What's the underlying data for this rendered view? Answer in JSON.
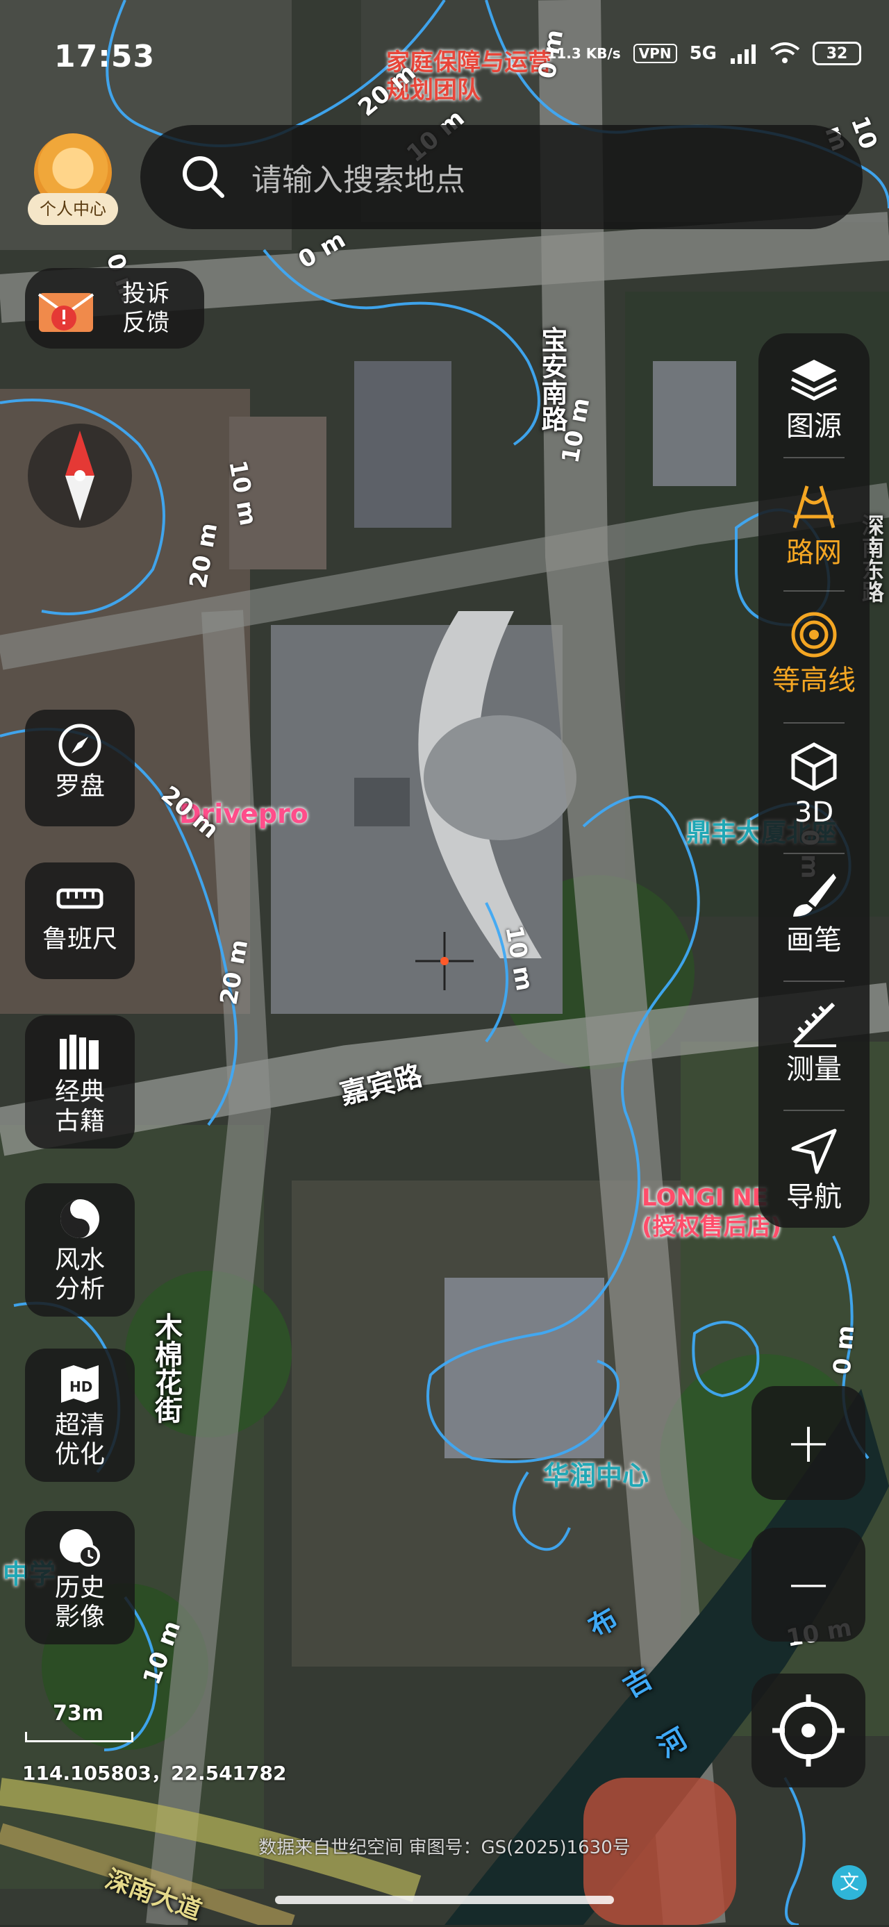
{
  "status_bar": {
    "time": "17:53",
    "net_speed": "11.3 KB/s",
    "vpn": "VPN",
    "network": "5G",
    "battery": "32"
  },
  "search": {
    "placeholder": "请输入搜索地点"
  },
  "profile": {
    "label": "个人中心"
  },
  "feedback": {
    "label_line1": "投诉",
    "label_line2": "反馈"
  },
  "left_tools": [
    {
      "label": "罗盘",
      "icon": "compass-icon"
    },
    {
      "label": "鲁班尺",
      "icon": "ruler-icon"
    },
    {
      "label": "经典\n古籍",
      "icon": "books-icon"
    },
    {
      "label": "风水\n分析",
      "icon": "yin-yang-icon"
    },
    {
      "label": "超清\n优化",
      "icon": "hd-map-icon"
    },
    {
      "label": "历史\n影像",
      "icon": "history-globe-icon"
    }
  ],
  "right_tools": [
    {
      "label": "图源",
      "icon": "layers-icon",
      "active": false
    },
    {
      "label": "路网",
      "icon": "road-network-icon",
      "active": true
    },
    {
      "label": "等高线",
      "icon": "contour-icon",
      "active": true
    },
    {
      "label": "3D",
      "icon": "cube-icon",
      "active": false
    },
    {
      "label": "画笔",
      "icon": "brush-icon",
      "active": false
    },
    {
      "label": "测量",
      "icon": "measure-icon",
      "active": false
    },
    {
      "label": "导航",
      "icon": "navigate-icon",
      "active": false
    }
  ],
  "zoom": {
    "in": "+",
    "out": "−"
  },
  "scale": {
    "value": "73m"
  },
  "coordinates": "114.105803，22.541782",
  "credit": "数据来自世纪空间 审图号：GS(2025)1630号",
  "map_labels": {
    "poi_top": "家庭保障与运营\n规划团队",
    "poi_drivepro": "Drivepro",
    "poi_dingfeng": "鼎丰大厦北座",
    "poi_longi": "LONGI NE\n(授权售后店)",
    "poi_crc": "华润中心",
    "poi_school": "中学",
    "road_baoan": "宝安南路",
    "road_jiabin": "嘉宾路",
    "road_mumian": "木棉花街",
    "river": "布吉河",
    "road_right": "深南东路",
    "road_bottom": "深南大道",
    "contour_0": "0 m",
    "contour_10": "10 m",
    "contour_20": "20 m"
  },
  "colors": {
    "accent": "#f4a623",
    "contour": "#3fa9f5",
    "panel": "#191919"
  }
}
